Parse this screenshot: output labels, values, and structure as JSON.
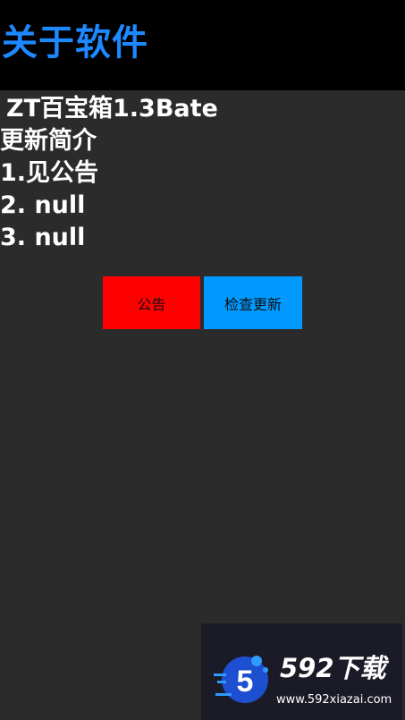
{
  "header": {
    "title": "关于软件",
    "background": "#000000",
    "title_color": "#1e88ff"
  },
  "info": {
    "app_name": "ZT百宝箱1.3Bate",
    "changelog_heading": "更新简介",
    "changelog_items": [
      "1.见公告",
      "2. null",
      "3. null"
    ]
  },
  "buttons": {
    "notice_label": "公告",
    "notice_color": "#ff0000",
    "update_label": "检查更新",
    "update_color": "#0099ff"
  },
  "watermark": {
    "logo_icon": "592-logo-icon",
    "logo_digit": "5",
    "brand": "592下载",
    "url": "www.592xiazai.com"
  },
  "colors": {
    "page_background": "#2b2b2b",
    "text": "#ffffff"
  }
}
